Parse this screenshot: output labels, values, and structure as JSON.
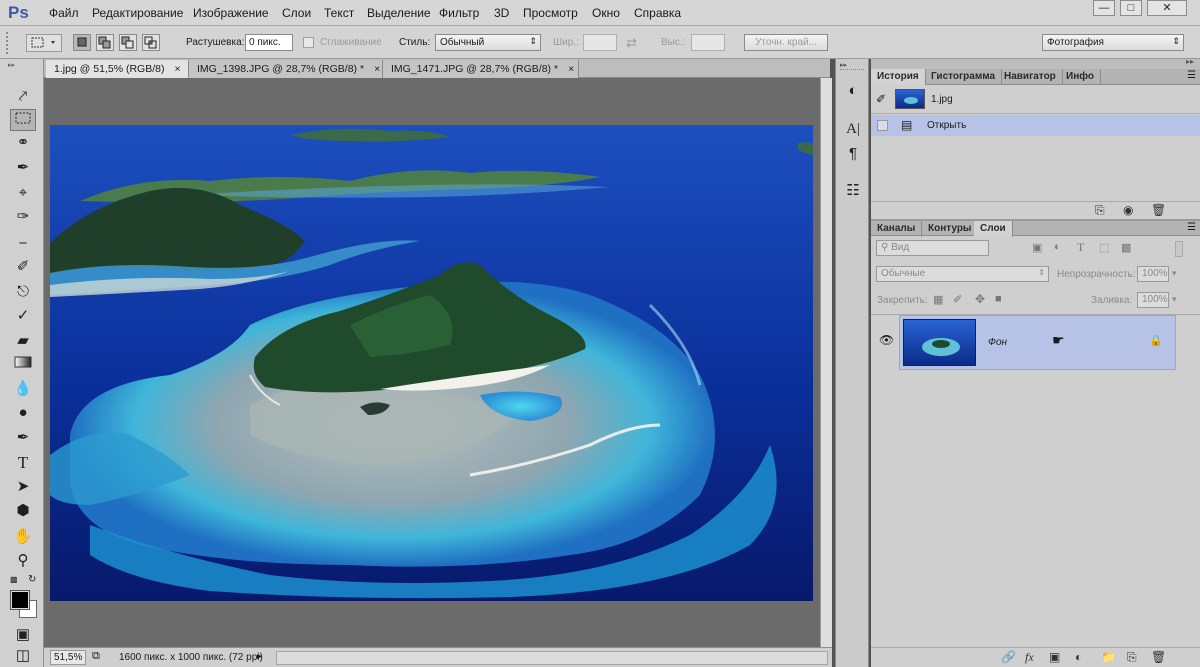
{
  "app": {
    "logo": "Ps",
    "menu": [
      "Файл",
      "Редактирование",
      "Изображение",
      "Слои",
      "Текст",
      "Выделение",
      "Фильтр",
      "3D",
      "Просмотр",
      "Окно",
      "Справка"
    ],
    "window_controls": [
      "minimize",
      "maximize",
      "close"
    ]
  },
  "options_bar": {
    "feather_label": "Растушевка:",
    "feather_value": "0 пикс.",
    "antialias_label": "Сглаживание",
    "style_label": "Стиль:",
    "style_value": "Обычный",
    "width_label": "Шир.:",
    "height_label": "Выс.:",
    "refine_edge": "Уточн. край...",
    "workspace": "Фотография"
  },
  "tabs": [
    {
      "label": "1.jpg @ 51,5% (RGB/8)",
      "active": true
    },
    {
      "label": "IMG_1398.JPG @ 28,7% (RGB/8) *",
      "active": false
    },
    {
      "label": "IMG_1471.JPG @ 28,7% (RGB/8) *",
      "active": false
    }
  ],
  "tools": [
    "move-icon",
    "marquee-icon",
    "lasso-icon",
    "quick-select-icon",
    "crop-icon",
    "eyedropper-icon",
    "healing-brush-icon",
    "brush-icon",
    "clone-stamp-icon",
    "history-brush-icon",
    "eraser-icon",
    "gradient-icon",
    "blur-icon",
    "dodge-icon",
    "pen-icon",
    "type-icon",
    "path-select-icon",
    "shape-icon",
    "hand-icon",
    "zoom-icon"
  ],
  "status": {
    "zoom": "51,5%",
    "doc_info": "1600 пикс. x 1000 пикс. (72 ppi)"
  },
  "history_panel": {
    "tabs": [
      "История",
      "Гистограмма",
      "Навигатор",
      "Инфо"
    ],
    "snapshot": "1.jpg",
    "states": [
      "Открыть"
    ]
  },
  "layers_panel": {
    "tabs": [
      "Каналы",
      "Контуры",
      "Слои"
    ],
    "filter_placeholder": "Вид",
    "blend_mode": "Обычные",
    "opacity_label": "Непрозрачность:",
    "opacity_value": "100%",
    "lock_label": "Закрепить:",
    "fill_label": "Заливка:",
    "fill_value": "100%",
    "layers": [
      {
        "name": "Фон",
        "visible": true,
        "locked": true
      }
    ]
  },
  "colors": {
    "menu_bg": "#d6d6d6",
    "canvas_bg": "#6b6b6b",
    "selected_layer": "#b7c3e6",
    "ps_logo": "#3d5aa8"
  }
}
